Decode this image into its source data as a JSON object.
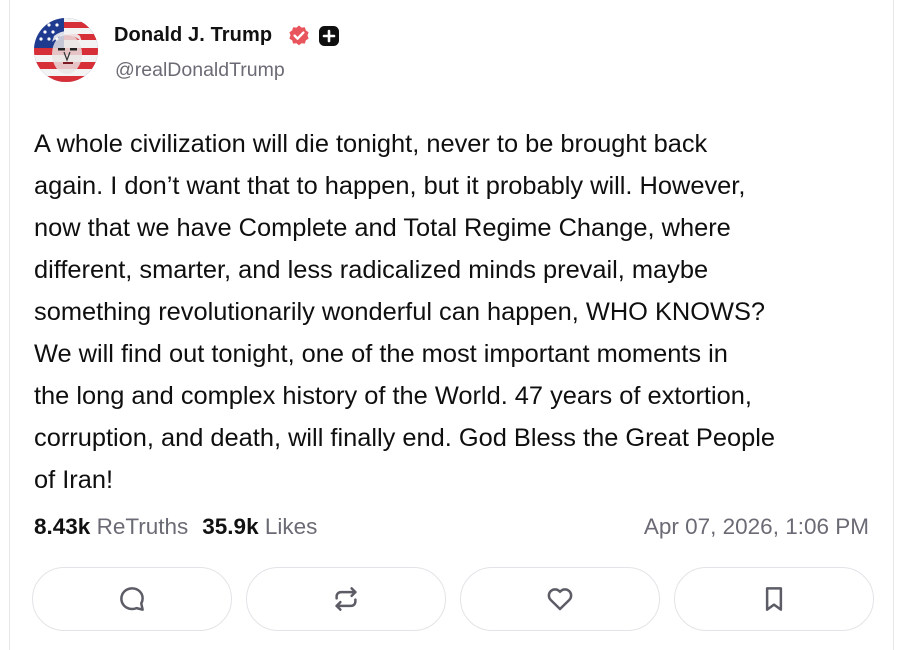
{
  "author": {
    "display_name": "Donald J. Trump",
    "handle": "@realDonaldTrump",
    "avatar_icon": "avatar-portrait-flag",
    "verified_badge_color": "#e8555c"
  },
  "post": {
    "lines": [
      "A whole civilization will die tonight, never to be brought back",
      "again. I don’t want that to happen, but it probably will. However,",
      "now that we have Complete and Total Regime Change, where",
      "different, smarter, and less radicalized minds prevail, maybe",
      "something revolutionarily wonderful can happen, WHO KNOWS?",
      "We will find out tonight, one of the most important moments in",
      "the long and complex history of the World. 47 years of extortion,",
      "corruption, and death, will finally end. God Bless the Great People",
      "of Iran!"
    ]
  },
  "stats": {
    "retruths_count": "8.43k",
    "retruths_label": "ReTruths",
    "likes_count": "35.9k",
    "likes_label": "Likes"
  },
  "timestamp": "Apr 07, 2026, 1:06 PM",
  "actions": [
    {
      "name": "reply",
      "icon": "comment-icon"
    },
    {
      "name": "retruth",
      "icon": "repost-icon"
    },
    {
      "name": "like",
      "icon": "heart-icon"
    },
    {
      "name": "bookmark",
      "icon": "bookmark-icon"
    }
  ],
  "colors": {
    "text": "#0f0f10",
    "muted": "#6b6b75",
    "border": "#e4e4e8",
    "icon": "#5c5c66"
  }
}
